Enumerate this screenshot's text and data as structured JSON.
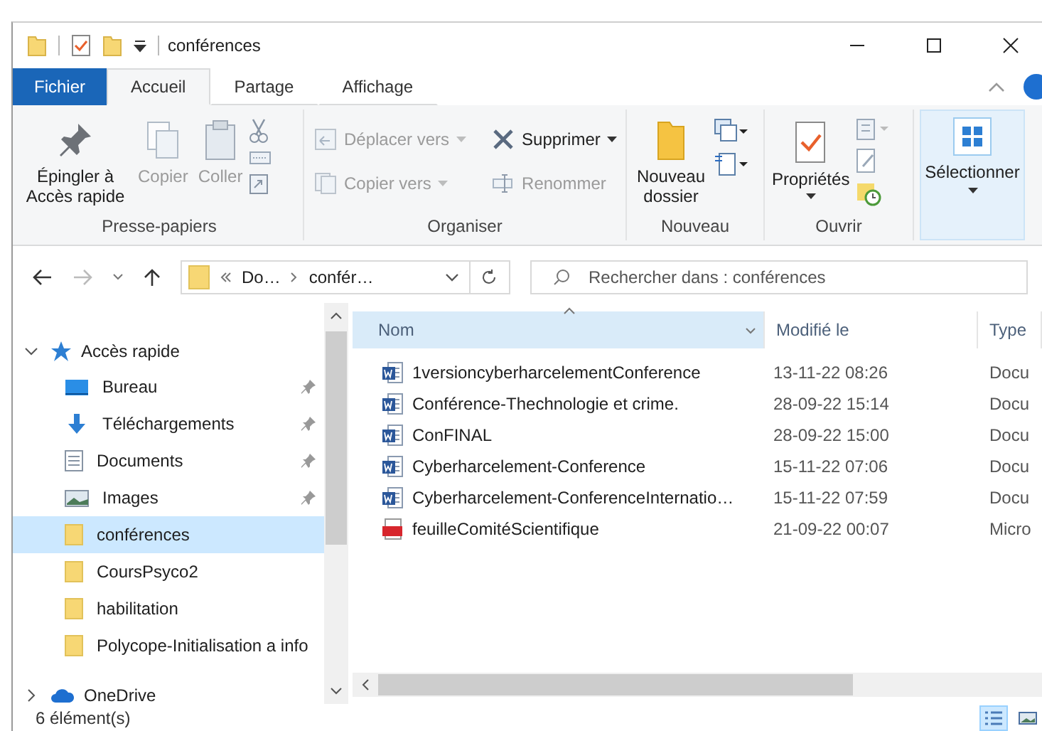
{
  "title_bar": {
    "title": "conférences"
  },
  "ribbon_tabs": [
    {
      "label": "Fichier",
      "kind": "file",
      "selected": false
    },
    {
      "label": "Accueil",
      "kind": "tab",
      "selected": true
    },
    {
      "label": "Partage",
      "kind": "tab",
      "selected": false
    },
    {
      "label": "Affichage",
      "kind": "tab",
      "selected": false
    }
  ],
  "ribbon_groups": [
    {
      "label": "Presse-papiers",
      "commands": [
        {
          "label": "Épingler à Accès rapide",
          "disabled": false
        },
        {
          "label": "Copier",
          "disabled": true
        },
        {
          "label": "Coller",
          "disabled": true
        }
      ]
    },
    {
      "label": "Organiser",
      "commands": [
        {
          "label": "Déplacer vers",
          "disabled": true
        },
        {
          "label": "Copier vers",
          "disabled": true
        },
        {
          "label": "Supprimer",
          "disabled": false
        },
        {
          "label": "Renommer",
          "disabled": true
        }
      ]
    },
    {
      "label": "Nouveau",
      "commands": [
        {
          "label": "Nouveau dossier",
          "disabled": false
        }
      ]
    },
    {
      "label": "Ouvrir",
      "commands": [
        {
          "label": "Propriétés",
          "disabled": false
        }
      ]
    }
  ],
  "select_button": {
    "label": "Sélectionner",
    "highlighted": true
  },
  "address": {
    "crumbs": [
      "Do…",
      "confér…"
    ]
  },
  "search": {
    "placeholder": "Rechercher dans : conférences"
  },
  "navigation": [
    {
      "label": "Accès rapide",
      "kind": "star",
      "expanded": true,
      "selected": false,
      "children": [
        {
          "label": "Bureau",
          "kind": "desktop",
          "pinned": true,
          "selected": false
        },
        {
          "label": "Téléchargements",
          "kind": "downloads",
          "pinned": true,
          "selected": false
        },
        {
          "label": "Documents",
          "kind": "documents",
          "pinned": true,
          "selected": false
        },
        {
          "label": "Images",
          "kind": "pictures",
          "pinned": true,
          "selected": false
        },
        {
          "label": "conférences",
          "kind": "folder",
          "pinned": false,
          "selected": true
        },
        {
          "label": "CoursPsyco2",
          "kind": "folder",
          "pinned": false,
          "selected": false
        },
        {
          "label": "habilitation",
          "kind": "folder",
          "pinned": false,
          "selected": false
        },
        {
          "label": "Polycope-Initialisation a info",
          "kind": "folder",
          "pinned": false,
          "selected": false
        }
      ]
    },
    {
      "label": "OneDrive",
      "kind": "cloud",
      "expanded": false,
      "selected": false
    }
  ],
  "columns": [
    {
      "label": "Nom",
      "sorted": true
    },
    {
      "label": "Modifié le",
      "sorted": false
    },
    {
      "label": "Type",
      "sorted": false
    }
  ],
  "files": [
    {
      "name": "1versioncyberharcelementConference",
      "modified": "13-11-22 08:26",
      "type": "Docu",
      "kind": "word"
    },
    {
      "name": "Conférence-Thechnologie et crime.",
      "modified": "28-09-22 15:14",
      "type": "Docu",
      "kind": "word"
    },
    {
      "name": "ConFINAL",
      "modified": "28-09-22 15:00",
      "type": "Docu",
      "kind": "word"
    },
    {
      "name": "Cyberharcelement-Conference",
      "modified": "15-11-22 07:06",
      "type": "Docu",
      "kind": "word"
    },
    {
      "name": "Cyberharcelement-ConferenceInternatio…",
      "modified": "15-11-22 07:59",
      "type": "Docu",
      "kind": "word"
    },
    {
      "name": "feuilleComitéScientifique",
      "modified": "21-09-22 00:07",
      "type": "Micro",
      "kind": "pdf"
    }
  ],
  "status_bar": {
    "count": "6 élément(s)"
  },
  "view_buttons": [
    {
      "kind": "details",
      "selected": true
    },
    {
      "kind": "tiles",
      "selected": false
    }
  ]
}
